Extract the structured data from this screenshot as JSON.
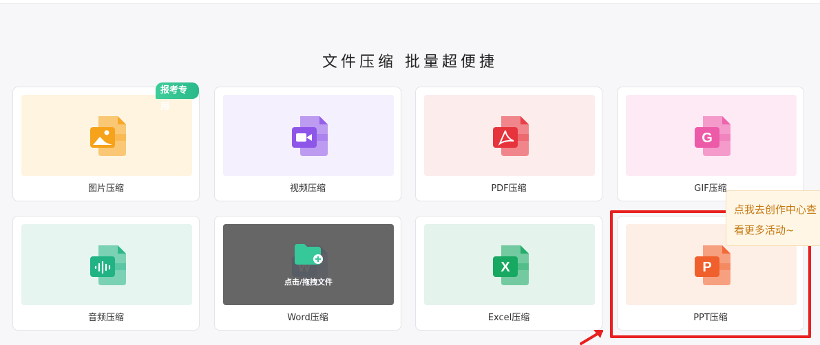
{
  "heading": "文件压缩  批量超便捷",
  "badge": "报考专用",
  "cards": [
    {
      "label": "图片压缩",
      "icon": "image-file-icon",
      "bg": "#fff4e0",
      "color": "#f6a21b",
      "glyph": "img"
    },
    {
      "label": "视频压缩",
      "icon": "video-file-icon",
      "bg": "#f4f0fd",
      "color": "#8e56e8",
      "glyph": "video"
    },
    {
      "label": "PDF压缩",
      "icon": "pdf-file-icon",
      "bg": "#fdecec",
      "color": "#e6333c",
      "glyph": "pdf"
    },
    {
      "label": "GIF压缩",
      "icon": "gif-file-icon",
      "bg": "#fdeaf5",
      "color": "#ec5aa8",
      "glyph": "G"
    },
    {
      "label": "音频压缩",
      "icon": "audio-file-icon",
      "bg": "#e6f5ef",
      "color": "#21b384",
      "glyph": "audio"
    },
    {
      "label": "Word压缩",
      "icon": "word-file-icon",
      "bg": "#e9eefb",
      "color": "#3d6fde",
      "glyph": "W"
    },
    {
      "label": "Excel压缩",
      "icon": "excel-file-icon",
      "bg": "#e4f3ec",
      "color": "#17a862",
      "glyph": "X"
    },
    {
      "label": "PPT压缩",
      "icon": "ppt-file-icon",
      "bg": "#fdeee6",
      "color": "#f0602c",
      "glyph": "P"
    }
  ],
  "drop_text": "点击/拖拽文件",
  "tooltip": {
    "line1": "点我去创作中心查",
    "line2": "看更多活动~"
  },
  "colors": {
    "highlight": "#e8201f",
    "tooltip_text": "#c47a12"
  }
}
